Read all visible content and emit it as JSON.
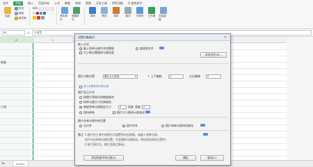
{
  "ribbon": {
    "menu": [
      "文件",
      "开始",
      "插入",
      "页面布局",
      "公式",
      "数据",
      "审阅",
      "视图",
      "开发工具",
      "特色功能",
      "Q 查找命令"
    ],
    "active_menu_index": 1,
    "row1": [
      "粘贴",
      "剪切",
      "复制",
      "格式刷"
    ],
    "row2_labels": [
      "宋体",
      "11",
      "条件格式",
      "表格样式",
      "求和",
      "筛选",
      "排序",
      "格式",
      "行和列",
      "工作表",
      "冻结窗格"
    ],
    "accent": "#24a25a"
  },
  "formula_bar": {
    "name_box": "B1",
    "fx": "fx",
    "value": "小语音"
  },
  "grid": {
    "columns": [
      "B",
      "C"
    ],
    "cells": [
      "地面",
      "小语"
    ],
    "sheet_tabs": [
      "Sheet1"
    ]
  },
  "dialog": {
    "title": "设置对象格式",
    "close": "×",
    "section_source": "嵌入方式",
    "opt_embed": "嵌入到单元格中文档数据",
    "opt_link": "链接到文件",
    "opt_link_note": "大小和位置随单元格而变",
    "browse_btn": "浏览文件(B)...",
    "position_label": "图片对象位置",
    "position_select": "图片大小改变",
    "lock_label": "↑ 上下偏移",
    "lock_val": "0",
    "left_label": "左右偏移",
    "left_val": "0",
    "hint_link": "插入对象到选中单元格",
    "section_size": "图片显示方式",
    "size_opt1": "按图片原始比例缩放填充",
    "size_opt2": "按单元格大小拉伸填充",
    "size_opt3": "缩放到单元格指定大小",
    "height_label": "高度",
    "height_val": "0",
    "width_label": "宽度",
    "width_val": "0",
    "size_opt4": "保持原有",
    "size_opt4_note": "图片大小随单元格变化",
    "section_group": "图片在单元格中的位置",
    "group_left": "左对齐",
    "group_center": "居中对齐",
    "group_right": "图片和单元格同时移动",
    "note_title": "备注",
    "note_line1": "1.图片在工具中选择后可放置到对应表格，或嵌入到单元格。",
    "note_line2": "  如不对应到单元格位置，不会随单元格移动，将出现在指定位置中。",
    "note_line3": "2.按下图片后，图片会随之移动。",
    "btn_primary": "添加到选中单元格(E)",
    "btn_ok": "确定",
    "btn_cancel": "取消(C)"
  }
}
